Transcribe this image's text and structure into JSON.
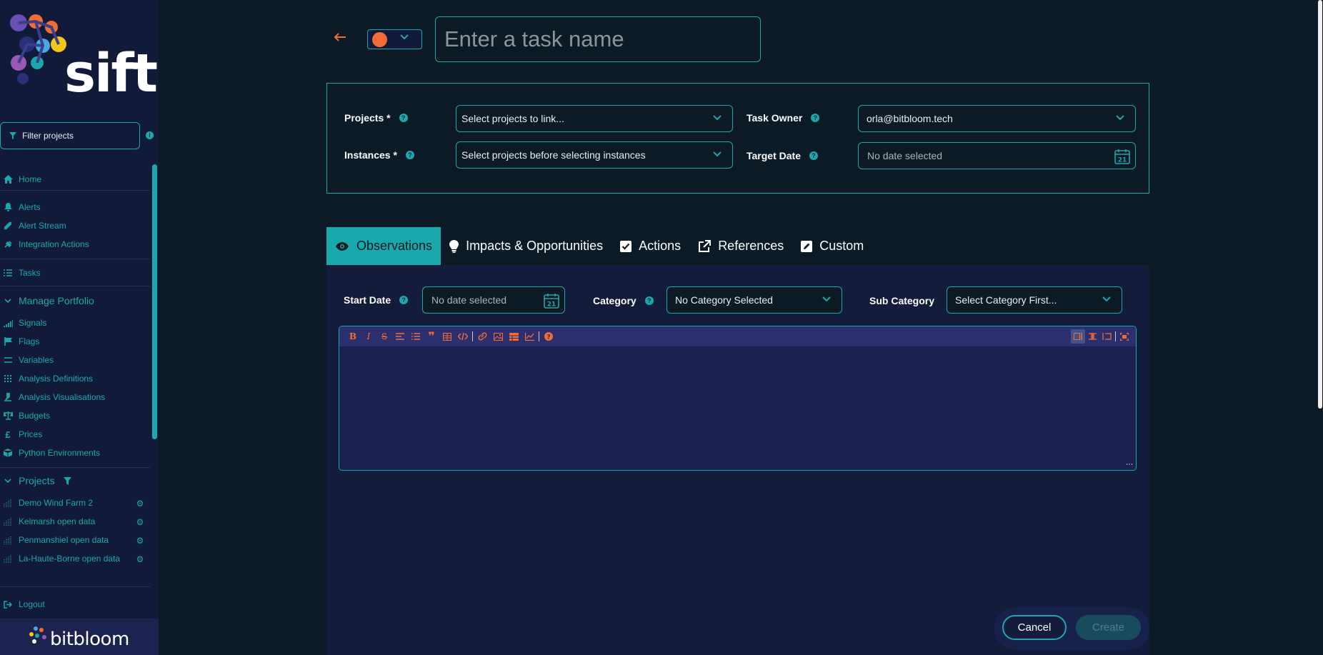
{
  "sidebar": {
    "logo_text": "sift",
    "filter_label": "Filter projects",
    "nav": {
      "home": "Home",
      "alerts": "Alerts",
      "alert_stream": "Alert Stream",
      "integration_actions": "Integration Actions",
      "tasks": "Tasks",
      "manage_portfolio": "Manage Portfolio",
      "signals": "Signals",
      "flags": "Flags",
      "variables": "Variables",
      "analysis_definitions": "Analysis Definitions",
      "analysis_visualisations": "Analysis Visualisations",
      "budgets": "Budgets",
      "prices": "Prices",
      "python_environments": "Python Environments",
      "projects": "Projects",
      "logout": "Logout"
    },
    "projects": [
      "Demo Wind Farm 2",
      "Kelmarsh open data",
      "Penmanshiel open data",
      "La-Haute-Borne open data"
    ],
    "footer_brand": "bitbloom"
  },
  "header": {
    "task_name_placeholder": "Enter a task name",
    "task_color": "#f26d36"
  },
  "form": {
    "projects_label": "Projects *",
    "projects_placeholder": "Select projects to link...",
    "instances_label": "Instances *",
    "instances_placeholder": "Select projects before selecting instances",
    "task_owner_label": "Task Owner",
    "task_owner_value": "orla@bitbloom.tech",
    "target_date_label": "Target Date",
    "target_date_value": "No date selected",
    "help_mark": "?"
  },
  "tabs": [
    {
      "label": "Observations",
      "icon": "eye-icon",
      "active": true
    },
    {
      "label": "Impacts & Opportunities",
      "icon": "lightbulb-icon",
      "active": false
    },
    {
      "label": "Actions",
      "icon": "checkbox-icon",
      "active": false
    },
    {
      "label": "References",
      "icon": "external-link-icon",
      "active": false
    },
    {
      "label": "Custom",
      "icon": "edit-icon",
      "active": false
    }
  ],
  "observations": {
    "start_date_label": "Start Date",
    "start_date_value": "No date selected",
    "category_label": "Category",
    "category_value": "No Category Selected",
    "sub_category_label": "Sub Category",
    "sub_category_value": "Select Category First...",
    "calendar_day": "21"
  },
  "actions": {
    "cancel": "Cancel",
    "create": "Create"
  },
  "colors": {
    "accent": "#1ba8ac",
    "orange": "#f26d36",
    "sidebar_bg": "#121a3a",
    "page_bg": "#0b1a24"
  }
}
